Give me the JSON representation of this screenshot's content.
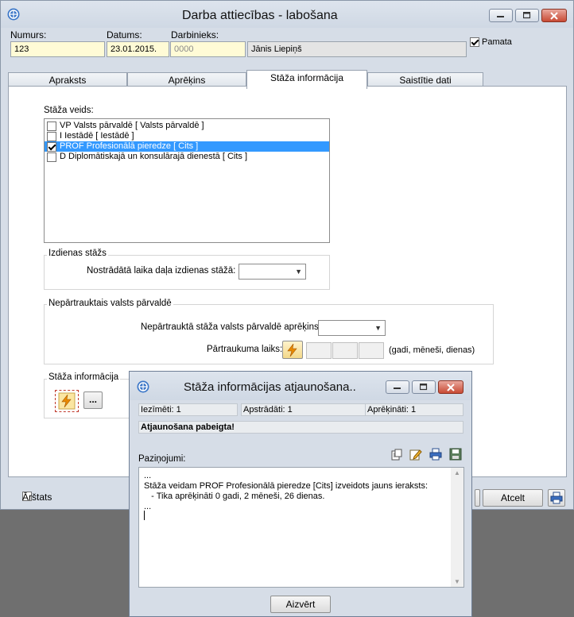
{
  "window": {
    "title": "Darba attiecības - labošana",
    "buttons": [
      "minimize",
      "maximize",
      "close"
    ]
  },
  "header": {
    "numurs_label": "Numurs:",
    "numurs_value": "123",
    "datums_label": "Datums:",
    "datums_value": "23.01.2015.",
    "darbinieks_label": "Darbinieks:",
    "darbinieks_code_placeholder": "0000",
    "darbinieks_name": "Jānis Liepiņš",
    "pamata_label": "Pamata",
    "pamata_checked": true
  },
  "tabs": [
    {
      "label": "Apraksts",
      "active": false
    },
    {
      "label": "Aprēķins",
      "active": false
    },
    {
      "label": "Stāža informācija",
      "active": true
    },
    {
      "label": "Saistītie dati",
      "active": false
    }
  ],
  "staza_veids": {
    "label": "Stāža veids:",
    "items": [
      {
        "label": "VP Valsts pārvaldē [ Valsts pārvaldē ]",
        "checked": false,
        "selected": false
      },
      {
        "label": "I Iestādē [ Iestādē ]",
        "checked": false,
        "selected": false
      },
      {
        "label": "PROF Profesionālā pieredze [ Cits ]",
        "checked": true,
        "selected": true
      },
      {
        "label": "D Diplomātiskajā un konsulārajā dienestā [ Cits ]",
        "checked": false,
        "selected": false
      }
    ]
  },
  "izdienas": {
    "title": "Izdienas stāžs",
    "label": "Nostrādātā laika daļa izdienas stāžā:",
    "value": ""
  },
  "nepartrauktais": {
    "title": "Nepārtrauktais valsts pārvaldē",
    "calc_label": "Nepārtrauktā stāža valsts pārvaldē aprēķins:",
    "calc_value": "",
    "break_label": "Pārtraukuma laiks:",
    "break_hint": "(gadi, mēneši, dienas)"
  },
  "staza_info": {
    "title": "Stāža informācija",
    "more_label": "..."
  },
  "footer": {
    "arstats_label": "Ārštats",
    "arstats_checked": false,
    "second_checked": true,
    "cancel_label": "Atcelt"
  },
  "dialog": {
    "title": "Stāža informācijas atjaunošana..",
    "iezimeti": "Iezīmēti: 1",
    "apstradati": "Apstrādāti: 1",
    "aprekinati": "Aprēķināti: 1",
    "status": "Atjaunošana pabeigta!",
    "pazinojumi_label": "Paziņojumi:",
    "log_lines": [
      "...",
      "Stāža veidam PROF Profesionālā pieredze [Cits] izveidots jauns ieraksts:",
      "   - Tika aprēķināti 0 gadi, 2 mēneši, 26 dienas.",
      "..."
    ],
    "close_label": "Aizvērt"
  },
  "colors": {
    "window_bg": "#d6dde7",
    "selection": "#3399ff",
    "input_yellow": "#fffbd6",
    "close_red": "#c84a34"
  }
}
